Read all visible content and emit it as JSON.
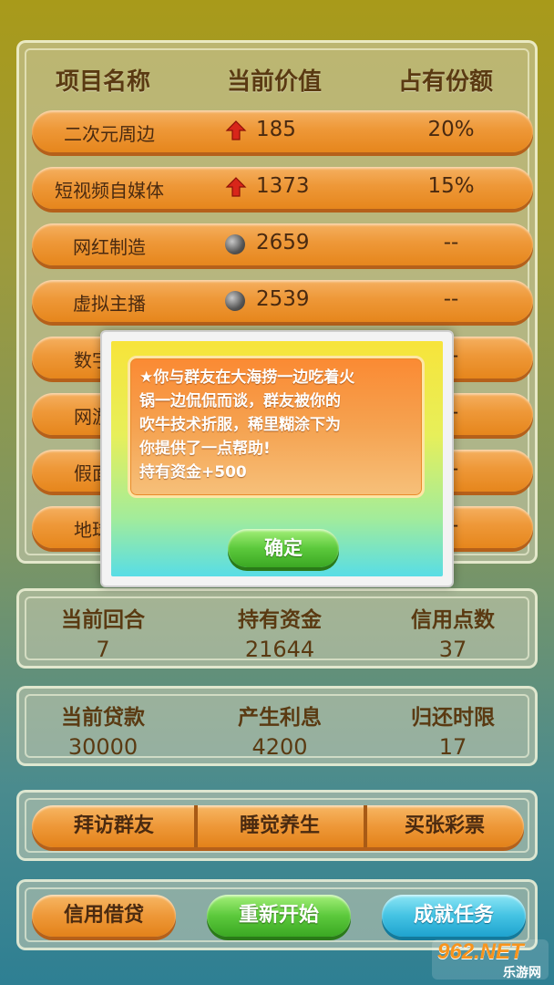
{
  "table": {
    "headers": [
      "项目名称",
      "当前价值",
      "占有份额"
    ],
    "rows": [
      {
        "name": "二次元周边",
        "trend": "up-arrow-icon",
        "value": "185",
        "share": "20%"
      },
      {
        "name": "短视频自媒体",
        "trend": "up-arrow-icon",
        "value": "1373",
        "share": "15%"
      },
      {
        "name": "网红制造",
        "trend": "neutral-dot-icon",
        "value": "2659",
        "share": "--"
      },
      {
        "name": "虚拟主播",
        "trend": "neutral-dot-icon",
        "value": "2539",
        "share": "--"
      },
      {
        "name": "数字",
        "trend": "",
        "value": "",
        "share": "--"
      },
      {
        "name": "网游",
        "trend": "",
        "value": "",
        "share": "--"
      },
      {
        "name": "假面",
        "trend": "",
        "value": "",
        "share": "--"
      },
      {
        "name": "地球",
        "trend": "",
        "value": "",
        "share": "--"
      }
    ]
  },
  "status": {
    "round_label": "当前回合",
    "round_value": "7",
    "funds_label": "持有资金",
    "funds_value": "21644",
    "credit_label": "信用点数",
    "credit_value": "37"
  },
  "loan": {
    "loan_label": "当前贷款",
    "loan_value": "30000",
    "interest_label": "产生利息",
    "interest_value": "4200",
    "deadline_label": "归还时限",
    "deadline_value": "17"
  },
  "actions": [
    "拜访群友",
    "睡觉养生",
    "买张彩票"
  ],
  "bottom_buttons": {
    "credit_loan": "信用借贷",
    "restart": "重新开始",
    "achievements": "成就任务"
  },
  "dialog": {
    "lines": [
      "★你与群友在大海捞一边吃着火",
      "锅一边侃侃而谈，群友被你的",
      "吹牛技术折服，稀里糊涂下为",
      "你提供了一点帮助!",
      "持有资金+500"
    ],
    "confirm": "确定"
  },
  "watermark": {
    "main": "962.NET",
    "sub": "乐游网"
  },
  "colors": {
    "row_orange": "#ee9838",
    "confirm_green": "#5cc93c",
    "achieve_blue": "#44c3e3",
    "text_brown": "#4a2a10"
  }
}
